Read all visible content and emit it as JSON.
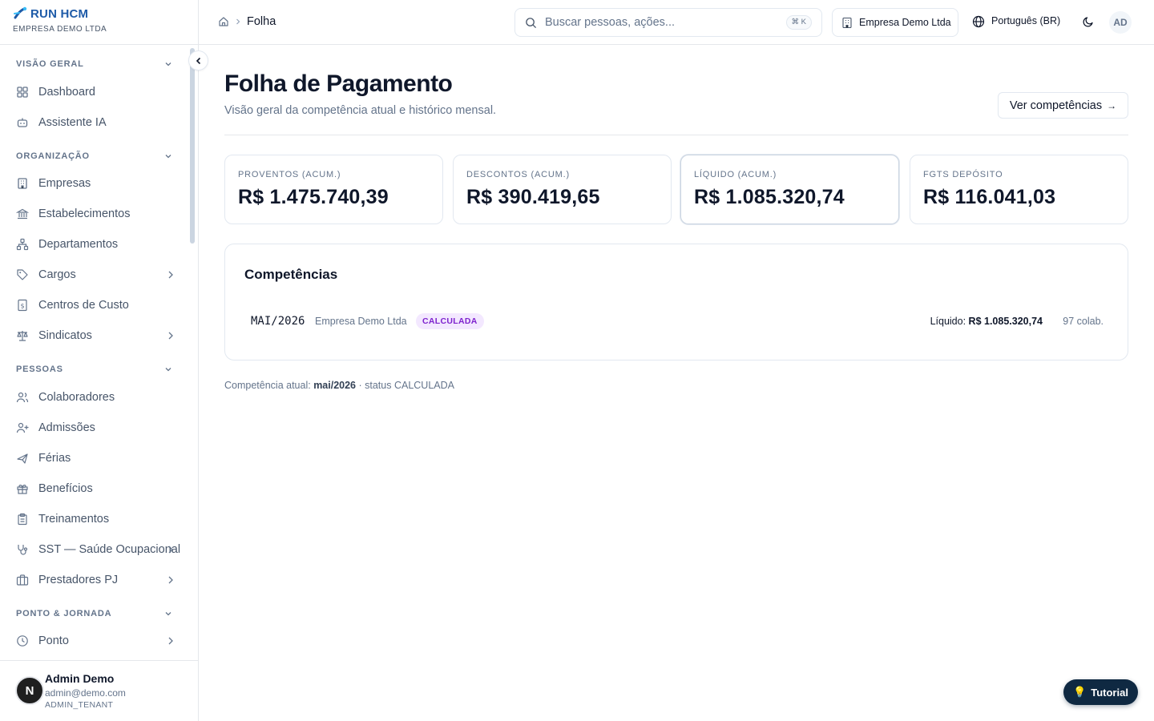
{
  "brand": {
    "name": "RUN HCM",
    "subtitle": "EMPRESA DEMO LTDA",
    "logo_icon": "runner-logo-icon"
  },
  "sidebar": {
    "sections": [
      {
        "label": "VISÃO GERAL",
        "items": [
          {
            "label": "Dashboard",
            "icon": "grid-icon",
            "has_children": false
          },
          {
            "label": "Assistente IA",
            "icon": "bot-icon",
            "has_children": false
          }
        ]
      },
      {
        "label": "ORGANIZAÇÃO",
        "items": [
          {
            "label": "Empresas",
            "icon": "building-icon",
            "has_children": false
          },
          {
            "label": "Estabelecimentos",
            "icon": "landmark-icon",
            "has_children": false
          },
          {
            "label": "Departamentos",
            "icon": "org-chart-icon",
            "has_children": false
          },
          {
            "label": "Cargos",
            "icon": "tag-icon",
            "has_children": true
          },
          {
            "label": "Centros de Custo",
            "icon": "receipt-icon",
            "has_children": false
          },
          {
            "label": "Sindicatos",
            "icon": "scale-icon",
            "has_children": true
          }
        ]
      },
      {
        "label": "PESSOAS",
        "items": [
          {
            "label": "Colaboradores",
            "icon": "users-icon",
            "has_children": false
          },
          {
            "label": "Admissões",
            "icon": "user-plus-icon",
            "has_children": false
          },
          {
            "label": "Férias",
            "icon": "plane-icon",
            "has_children": false
          },
          {
            "label": "Benefícios",
            "icon": "gift-icon",
            "has_children": false
          },
          {
            "label": "Treinamentos",
            "icon": "clipboard-icon",
            "has_children": false
          },
          {
            "label": "SST — Saúde Ocupacional",
            "icon": "stethoscope-icon",
            "has_children": true
          },
          {
            "label": "Prestadores PJ",
            "icon": "briefcase-icon",
            "has_children": true
          }
        ]
      },
      {
        "label": "PONTO & JORNADA",
        "items": [
          {
            "label": "Ponto",
            "icon": "clock-icon",
            "has_children": true
          }
        ]
      }
    ]
  },
  "user": {
    "initial": "N",
    "name": "Admin Demo",
    "email": "admin@demo.com",
    "role": "ADMIN_TENANT"
  },
  "topbar": {
    "breadcrumb_current": "Folha",
    "search_placeholder": "Buscar pessoas, ações...",
    "search_shortcut": "⌘ K",
    "company": "Empresa Demo Ltda",
    "language": "Português (BR)",
    "avatar_initials": "AD"
  },
  "page": {
    "title": "Folha de Pagamento",
    "subtitle": "Visão geral da competência atual e histórico mensal.",
    "action_label": "Ver competências",
    "action_arrow": "→"
  },
  "stats": [
    {
      "label": "PROVENTOS (ACUM.)",
      "value": "R$ 1.475.740,39"
    },
    {
      "label": "DESCONTOS (ACUM.)",
      "value": "R$ 390.419,65"
    },
    {
      "label": "LÍQUIDO (ACUM.)",
      "value": "R$ 1.085.320,74"
    },
    {
      "label": "FGTS DEPÓSITO",
      "value": "R$ 116.041,03"
    }
  ],
  "competencias": {
    "title": "Competências",
    "rows": [
      {
        "code": "MAI/2026",
        "company": "Empresa Demo Ltda",
        "status": "CALCULADA",
        "liquido_label": "Líquido:",
        "liquido_value": "R$ 1.085.320,74",
        "colab": "97 colab."
      }
    ]
  },
  "footer": {
    "prefix": "Competência atual:",
    "period": "mai/2026",
    "suffix": "· status CALCULADA"
  },
  "tutorial": {
    "label": "Tutorial",
    "icon": "lightbulb-icon"
  },
  "colors": {
    "brand": "#1e5ba8",
    "badge_bg": "#f3e8ff",
    "badge_text": "#7e22ce",
    "tutorial_bg": "#0f2942"
  }
}
